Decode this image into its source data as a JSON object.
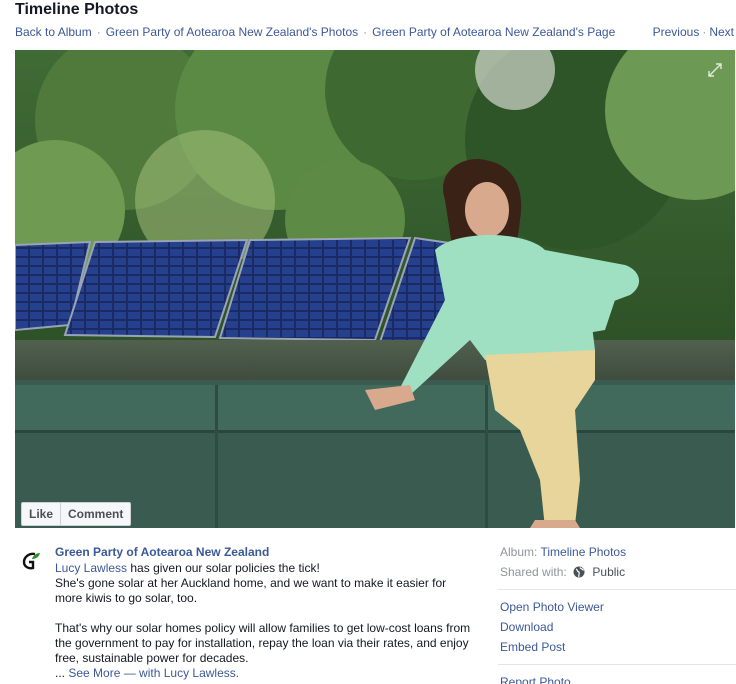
{
  "page": {
    "title": "Timeline Photos"
  },
  "breadcrumb": {
    "back": "Back to Album",
    "photos": "Green Party of Aotearoa New Zealand's Photos",
    "page": "Green Party of Aotearoa New Zealand's Page"
  },
  "pager": {
    "previous": "Previous",
    "next": "Next"
  },
  "photo_actions": {
    "like": "Like",
    "comment": "Comment"
  },
  "post": {
    "author": "Green Party of Aotearoa New Zealand",
    "mention": "Lucy Lawless",
    "line1_rest": " has given our solar policies the tick!",
    "line2": "She's gone solar at her Auckland home, and we want to make it easier for more kiwis to go solar, too.",
    "line3": "That's why our solar homes policy will allow families to get low-cost loans from the government to pay for installation, repay the loan via their rates, and enjoy free, sustainable power for decades.",
    "ellipsis": "... ",
    "see_more": "See More",
    "with_text": " — with ",
    "with_name": "Lucy Lawless",
    "end": "."
  },
  "sidebar": {
    "album_label": "Album:",
    "album_value": "Timeline Photos",
    "shared_label": "Shared with:",
    "shared_value": "Public",
    "actions": {
      "viewer": "Open Photo Viewer",
      "download": "Download",
      "embed": "Embed Post",
      "report": "Report Photo"
    }
  },
  "colors": {
    "link": "#3b5998",
    "muted": "#90949c",
    "party_green": "#2a8f2a"
  },
  "icons": {
    "expand": "expand-icon",
    "globe": "globe-icon",
    "avatar": "green-party-logo-icon"
  }
}
